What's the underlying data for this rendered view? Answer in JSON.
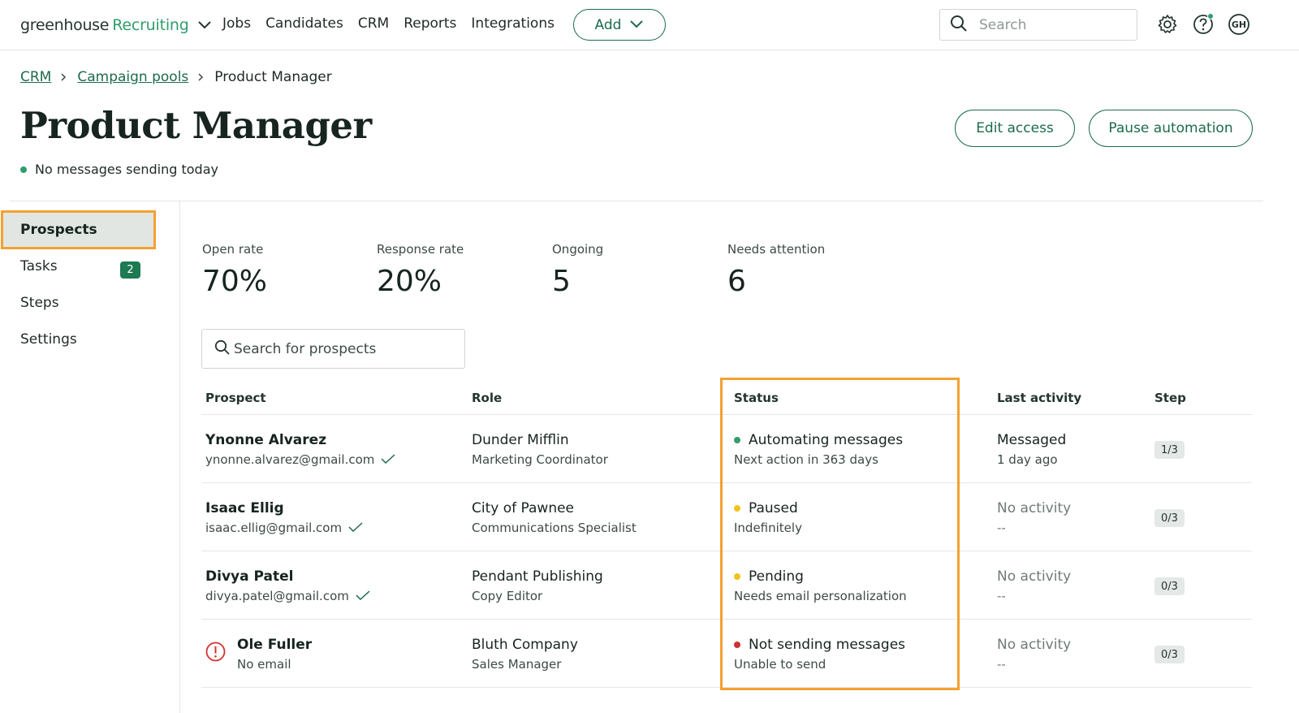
{
  "brand": {
    "name": "greenhouse",
    "product": "Recruiting"
  },
  "nav": [
    "Jobs",
    "Candidates",
    "CRM",
    "Reports",
    "Integrations"
  ],
  "add_label": "Add",
  "search": {
    "placeholder": "Search"
  },
  "breadcrumb": {
    "crm": "CRM",
    "campaign_pools": "Campaign pools",
    "current": "Product Manager"
  },
  "page": {
    "title": "Product Manager",
    "status": "No messages sending today"
  },
  "actions": {
    "edit_access": "Edit access",
    "pause_automation": "Pause automation"
  },
  "user_initials": "GH",
  "sidebar": {
    "prospects": "Prospects",
    "tasks": "Tasks",
    "tasks_count": "2",
    "steps": "Steps",
    "settings": "Settings"
  },
  "stats": [
    {
      "label": "Open rate",
      "value": "70%"
    },
    {
      "label": "Response rate",
      "value": "20%"
    },
    {
      "label": "Ongoing",
      "value": "5"
    },
    {
      "label": "Needs attention",
      "value": "6"
    }
  ],
  "prospect_search": {
    "placeholder": "Search for prospects"
  },
  "table": {
    "headers": {
      "prospect": "Prospect",
      "role": "Role",
      "status": "Status",
      "last_activity": "Last activity",
      "step": "Step"
    },
    "rows": [
      {
        "name": "Ynonne Alvarez",
        "email": "ynonne.alvarez@gmail.com",
        "company": "Dunder Mifflin",
        "role": "Marketing Coordinator",
        "status": "Automating messages",
        "status_detail": "Next action in 363 days",
        "activity": "Messaged",
        "activity_detail": "1 day ago",
        "step": "1/3"
      },
      {
        "name": "Isaac Ellig",
        "email": "isaac.ellig@gmail.com",
        "company": "City of Pawnee",
        "role": "Communications Specialist",
        "status": "Paused",
        "status_detail": "Indefinitely",
        "activity": "No activity",
        "activity_detail": "--",
        "step": "0/3"
      },
      {
        "name": "Divya Patel",
        "email": "divya.patel@gmail.com",
        "company": "Pendant Publishing",
        "role": "Copy Editor",
        "status": "Pending",
        "status_detail": "Needs email personalization",
        "activity": "No activity",
        "activity_detail": "--",
        "step": "0/3"
      },
      {
        "name": "Ole Fuller",
        "email": "No email",
        "company": "Bluth Company",
        "role": "Sales Manager",
        "status": "Not sending messages",
        "status_detail": "Unable to send",
        "activity": "No activity",
        "activity_detail": "--",
        "step": "0/3"
      }
    ]
  },
  "colors": {
    "brand_green": "#1d6b4b",
    "status_green": "#2f9d6c",
    "status_yellow": "#f2c21b",
    "status_red": "#d0312d",
    "highlight_orange": "#f5a031"
  },
  "icons": [
    "chevron-down-icon",
    "search-icon",
    "gear-icon",
    "help-icon",
    "checkmark-icon",
    "error-icon"
  ]
}
